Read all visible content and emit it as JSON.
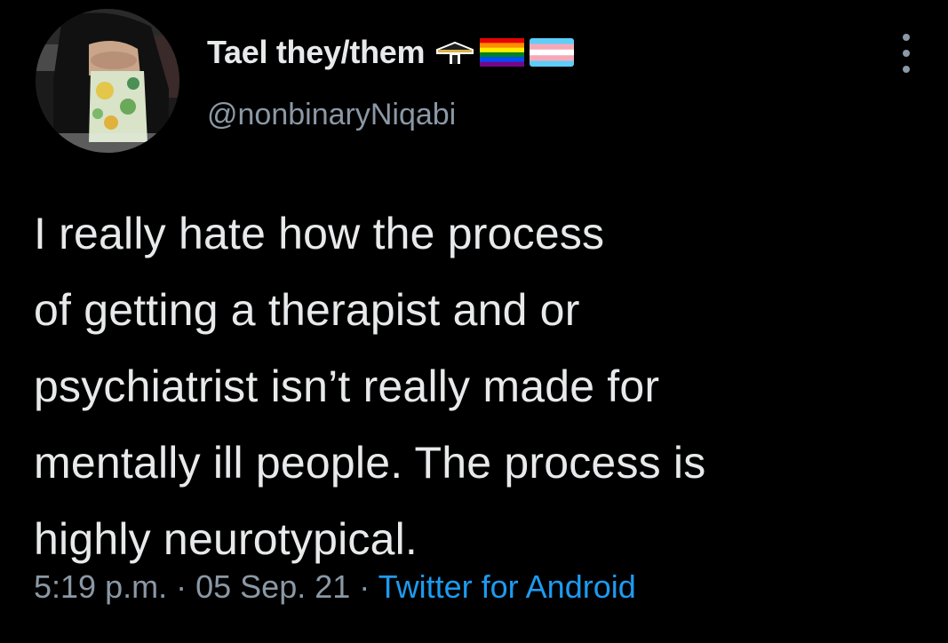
{
  "author": {
    "display_name": "Tael they/them",
    "handle": "@nonbinaryNiqabi",
    "name_emojis": [
      "kaaba-emoji",
      "rainbow-flag-emoji",
      "transgender-flag-emoji"
    ]
  },
  "tweet": {
    "text_lines": [
      "I really hate how the process",
      "of getting a therapist and or",
      "psychiatrist isn’t really made for",
      "mentally ill people. The process is",
      "highly neurotypical."
    ]
  },
  "meta": {
    "time": "5:19 p.m.",
    "separator": "·",
    "date": "05 Sep. 21",
    "source": "Twitter for Android"
  },
  "colors": {
    "background": "#000000",
    "primary_text": "#e7e9ea",
    "secondary_text": "#8b98a5",
    "link": "#1d9bf0"
  },
  "icons": {
    "more": "more-vertical-icon"
  }
}
